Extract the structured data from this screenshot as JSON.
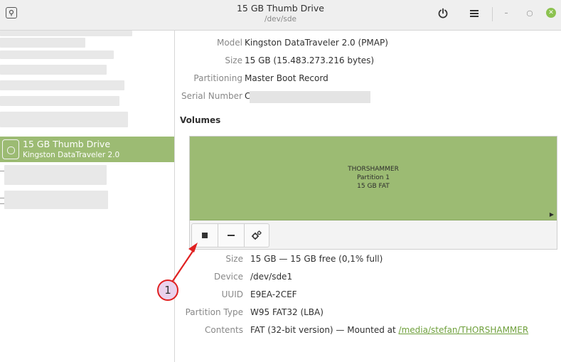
{
  "header": {
    "title": "15 GB Thumb Drive",
    "subtitle": "/dev/sde",
    "power_icon": "power-icon",
    "menu_icon": "hamburger-menu-icon"
  },
  "sidebar": {
    "selected": {
      "name": "15 GB Thumb Drive",
      "subtitle": "Kingston DataTraveler 2.0"
    }
  },
  "drive": {
    "model": {
      "label": "Model",
      "value": "Kingston DataTraveler 2.0 (PMAP)"
    },
    "size": {
      "label": "Size",
      "value": "15 GB (15.483.273.216 bytes)"
    },
    "partitioning": {
      "label": "Partitioning",
      "value": "Master Boot Record"
    },
    "serial": {
      "label": "Serial Number",
      "value": "C"
    }
  },
  "volumes": {
    "heading": "Volumes",
    "partition": {
      "name": "THORSHAMMER",
      "number": "Partition 1",
      "desc": "15 GB FAT"
    },
    "toolbar": {
      "stop_icon": "stop-icon",
      "remove_icon": "minus-icon",
      "settings_icon": "gears-icon"
    }
  },
  "partition_details": {
    "size": {
      "label": "Size",
      "value": "15 GB — 15 GB free (0,1% full)"
    },
    "device": {
      "label": "Device",
      "value": "/dev/sde1"
    },
    "uuid": {
      "label": "UUID",
      "value": "E9EA-2CEF"
    },
    "type": {
      "label": "Partition Type",
      "value": "W95 FAT32 (LBA)"
    },
    "contents": {
      "label": "Contents",
      "value": "FAT (32-bit version) — Mounted at ",
      "link": "/media/stefan/THORSHAMMER"
    }
  },
  "annotation": {
    "number": "1"
  },
  "colors": {
    "accent": "#9cbb73",
    "link": "#6fa03c",
    "annotation": "#e02020"
  }
}
